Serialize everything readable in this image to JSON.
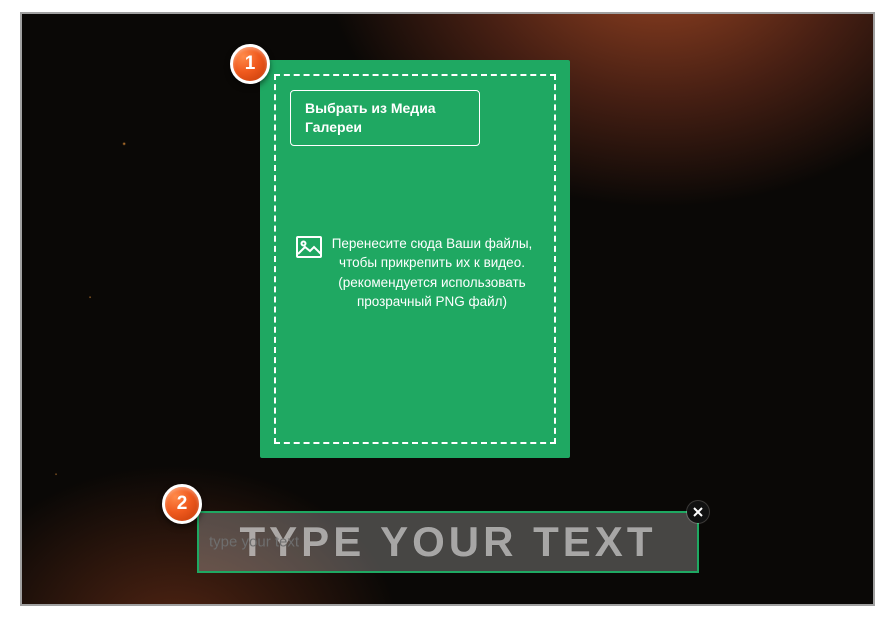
{
  "dropzone": {
    "gallery_button": "Выбрать из Медиа Галереи",
    "hint": "Перенесите сюда Ваши файлы, чтобы прикрепить их к видео. (рекомендуется использовать прозрачный PNG файл)"
  },
  "text_field": {
    "ghost": "TYPE YOUR TEXT",
    "placeholder": "type your text",
    "value": ""
  },
  "badges": {
    "one": "1",
    "two": "2"
  },
  "colors": {
    "accent_green": "#1fa862",
    "badge_orange": "#f05a1e"
  }
}
